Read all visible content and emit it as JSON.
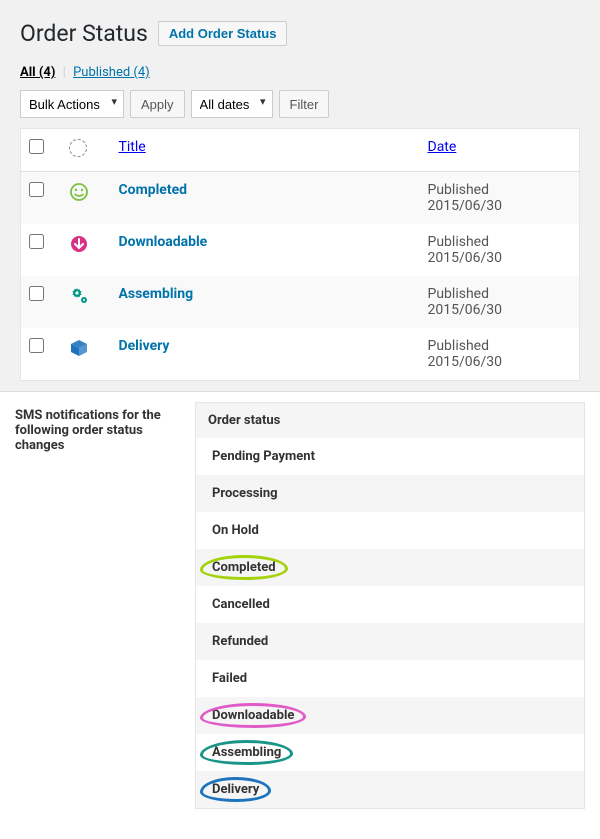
{
  "header": {
    "title": "Order Status",
    "add_btn": "Add Order Status"
  },
  "subsub": {
    "all_label": "All",
    "all_count": "(4)",
    "published_label": "Published",
    "published_count": "(4)"
  },
  "controls": {
    "bulk_actions": "Bulk Actions",
    "apply": "Apply",
    "all_dates": "All dates",
    "filter": "Filter"
  },
  "columns": {
    "title": "Title",
    "date": "Date"
  },
  "rows": [
    {
      "icon": "smiley",
      "color": "#7ac143",
      "title": "Completed",
      "status": "Published",
      "date": "2015/06/30"
    },
    {
      "icon": "arrow",
      "color": "#d63384",
      "title": "Downloadable",
      "status": "Published",
      "date": "2015/06/30"
    },
    {
      "icon": "gears",
      "color": "#009688",
      "title": "Assembling",
      "status": "Published",
      "date": "2015/06/30"
    },
    {
      "icon": "cube",
      "color": "#1e73be",
      "title": "Delivery",
      "status": "Published",
      "date": "2015/06/30"
    }
  ],
  "bottom": {
    "left_label": "SMS notifications for the following order status changes",
    "header": "Order status",
    "statuses": [
      {
        "label": "Pending Payment",
        "circle": null
      },
      {
        "label": "Processing",
        "circle": null
      },
      {
        "label": "On Hold",
        "circle": null
      },
      {
        "label": "Completed",
        "circle": "#a4d20b"
      },
      {
        "label": "Cancelled",
        "circle": null
      },
      {
        "label": "Refunded",
        "circle": null
      },
      {
        "label": "Failed",
        "circle": null
      },
      {
        "label": "Downloadable",
        "circle": "#e05bc8"
      },
      {
        "label": "Assembling",
        "circle": "#1a9688"
      },
      {
        "label": "Delivery",
        "circle": "#1e73be"
      }
    ]
  },
  "icons": {
    "smiley": "smiley-icon",
    "arrow": "arrow-down-circle-icon",
    "gears": "gears-icon",
    "cube": "cube-icon"
  }
}
